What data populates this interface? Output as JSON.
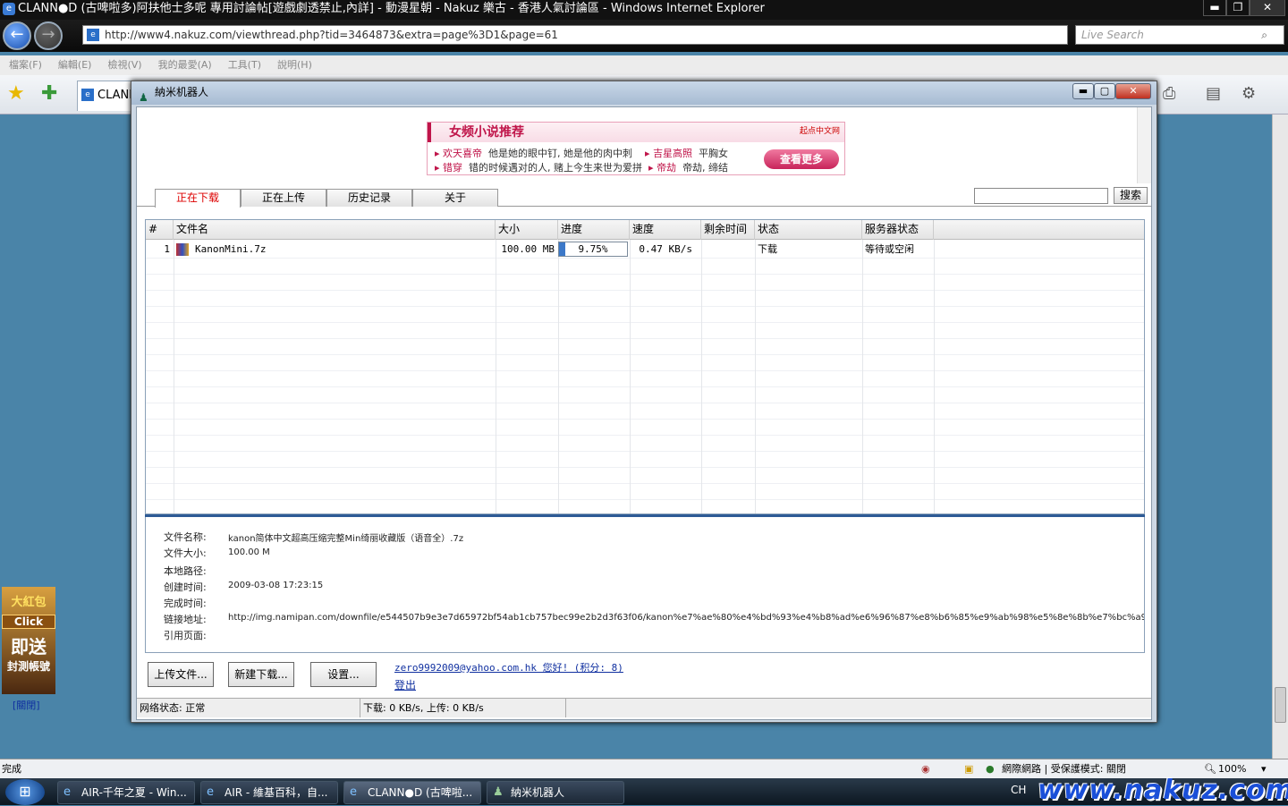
{
  "ie": {
    "title": "CLANN●D (古啤啦多)阿扶他士多呢 專用討論帖[遊戲劇透禁止,內詳] - 動漫星朝 - Nakuz 樂古 - 香港人氣討論區 - Windows Internet Explorer",
    "url": "http://www4.nakuz.com/viewthread.php?tid=3464873&extra=page%3D1&page=61",
    "search_placeholder": "Live Search",
    "menu": [
      "檔案(F)",
      "編輯(E)",
      "檢視(V)",
      "我的最愛(A)",
      "工具(T)",
      "說明(H)"
    ],
    "tab_label": "CLANN",
    "status_text": "完成",
    "zone_text": "網際網路 | 受保護模式: 關閉",
    "zoom": "100%",
    "ad_close": "[關閉]",
    "ad_text": [
      "大紅包",
      "Click",
      "即送",
      "封測帳號"
    ]
  },
  "taskbar": {
    "items": [
      "AIR-千年之夏 - Win...",
      "AIR - 維基百科，自...",
      "CLANN●D (古啤啦...",
      "納米机器人"
    ],
    "lang": "CH",
    "watermark": "www.nakuz.com"
  },
  "robot": {
    "title": "納米机器人",
    "ad": {
      "heading": "女频小说推荐",
      "logo": "起点中文网",
      "lines": [
        {
          "a": "欢天喜帝",
          "b": "他是她的眼中钉, 她是他的肉中刺",
          "c": "吉星高照",
          "d": "平胸女"
        },
        {
          "a": "错穿",
          "b": "错的时候遇对的人, 赌上今生来世为爱拼",
          "c": "帝劫",
          "d": "帝劫, 缔结"
        }
      ],
      "more": "查看更多"
    },
    "tabs": [
      "正在下载",
      "正在上传",
      "历史记录",
      "关于"
    ],
    "search_btn": "搜索",
    "columns": [
      "#",
      "文件名",
      "大小",
      "进度",
      "速度",
      "剩余时间",
      "状态",
      "服务器状态"
    ],
    "rows": [
      {
        "num": "1",
        "name": "KanonMini.7z",
        "size": "100.00 MB",
        "progress": "9.75%",
        "progress_value": 0.0975,
        "speed": "0.47 KB/s",
        "remaining": "",
        "status": "下载",
        "server": "等待或空闲"
      }
    ],
    "details": {
      "labels": [
        "文件名称:",
        "文件大小:",
        "本地路径:",
        "创建时间:",
        "完成时间:",
        "链接地址:",
        "引用页面:"
      ],
      "values": [
        "kanon简体中文超高压缩完整Min绮丽收藏版（语音全）.7z",
        "100.00 M",
        "",
        "2009-03-08 17:23:15",
        "",
        "http://img.namipan.com/downfile/e544507b9e3e7d65972bf54ab1cb757bec99e2b2d3f63f06/kanon%e7%ae%80%e4%bd%93%e4%b8%ad%e6%96%87%e8%b6%85%e9%ab%98%e5%8e%8b%e7%bc%a9",
        ""
      ]
    },
    "buttons": [
      "上传文件...",
      "新建下载...",
      "设置..."
    ],
    "user": "zero9992009@yahoo.com.hk 您好! (积分: 8)",
    "logout": "登出",
    "net_status": "网络状态: 正常",
    "speed_status": "下载: 0 KB/s, 上传: 0 KB/s"
  }
}
